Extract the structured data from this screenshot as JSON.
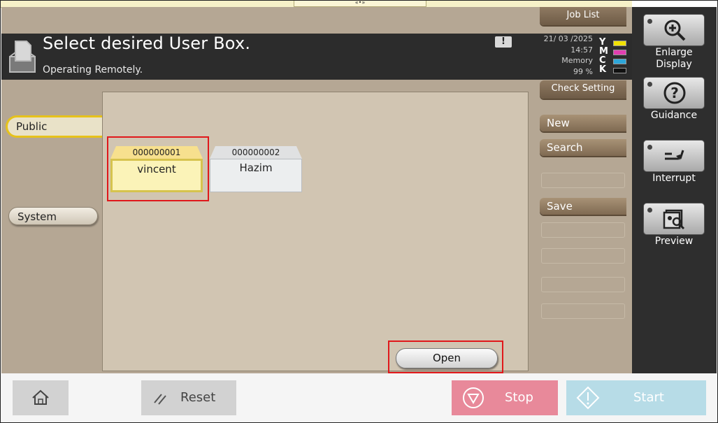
{
  "header": {
    "title": "Select desired User Box.",
    "subtitle": "Operating Remotely.",
    "alert_glyph": "!",
    "date": "21/ 03 /2025",
    "time": "14:57",
    "memory_label": "Memory",
    "memory_value": "99 %",
    "toner": [
      {
        "letter": "Y",
        "color": "#f2e200"
      },
      {
        "letter": "M",
        "color": "#e23fb0"
      },
      {
        "letter": "C",
        "color": "#2ea6d9"
      },
      {
        "letter": "K",
        "color": "#111111"
      }
    ]
  },
  "top": {
    "job_list": "Job List",
    "check_setting": "Check Setting",
    "handle_glyph": "«•»"
  },
  "tabs": [
    {
      "label": "Public",
      "selected": true
    },
    {
      "label": "System",
      "selected": false
    }
  ],
  "boxes": [
    {
      "number": "000000001",
      "name": "vincent",
      "selected": true
    },
    {
      "number": "000000002",
      "name": "Hazim",
      "selected": false
    }
  ],
  "open_button": "Open",
  "side_menu": {
    "new": "New",
    "search": "Search",
    "save": "Save"
  },
  "right_panel": [
    {
      "label_line1": "Enlarge",
      "label_line2": "Display",
      "icon": "zoom-in-icon"
    },
    {
      "label_line1": "Guidance",
      "label_line2": "",
      "icon": "help-icon"
    },
    {
      "label_line1": "Interrupt",
      "label_line2": "",
      "icon": "interrupt-icon"
    },
    {
      "label_line1": "Preview",
      "label_line2": "",
      "icon": "preview-icon"
    }
  ],
  "bottom_bar": {
    "reset": "Reset",
    "stop": "Stop",
    "start": "Start"
  },
  "colors": {
    "accent_yellow": "#e6c21b",
    "highlight_red": "#e0181b",
    "stop": "#e8899a",
    "start": "#b7dce7"
  }
}
